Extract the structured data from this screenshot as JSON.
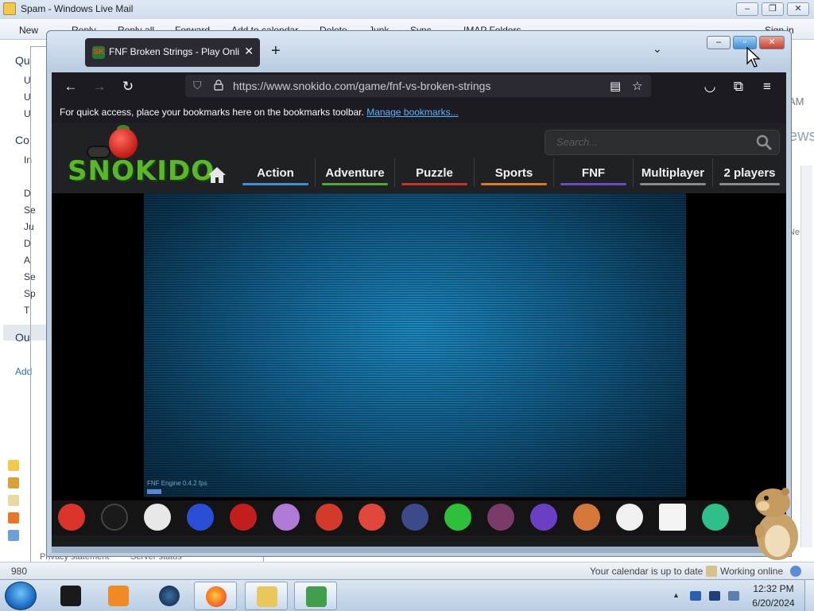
{
  "background_app": {
    "title": "Spam - Windows Live Mail",
    "ribbon": [
      "New",
      "Reply",
      "Reply all",
      "Forward",
      "Add to calendar",
      "Delete",
      "Junk",
      "Sync",
      "IMAP Folders",
      "Sign in"
    ],
    "sidebar_headers": [
      "Qu",
      "Co",
      "Ou"
    ],
    "sidebar_items": [
      "U",
      "U",
      "U",
      "In",
      "D",
      "Se",
      "Ju",
      "D",
      "A",
      "Se",
      "Sp",
      "T"
    ],
    "add_link": "Add",
    "right_fragments": [
      "AM",
      "ews",
      "Ne"
    ],
    "status_left": "980",
    "status_right_calendar": "Your calendar is up to date",
    "status_right_online": "Working online",
    "under_links": [
      "Privacy statement",
      "Server status"
    ]
  },
  "browser": {
    "tab_title": "FNF Broken Strings - Play Online",
    "tab_favicon": "SK",
    "url": "https://www.snokido.com/game/fnf-vs-broken-strings",
    "bookmarks_hint": "For quick access, place your bookmarks here on the bookmarks toolbar.",
    "bookmarks_link": "Manage bookmarks..."
  },
  "site": {
    "logo": "SNOKIDO",
    "search_placeholder": "Search...",
    "categories": [
      {
        "label": "Action",
        "color": "#3f8fd6"
      },
      {
        "label": "Adventure",
        "color": "#4fa832"
      },
      {
        "label": "Puzzle",
        "color": "#c8322a"
      },
      {
        "label": "Sports",
        "color": "#e07a1f"
      },
      {
        "label": "FNF",
        "color": "#6a4bc4"
      },
      {
        "label": "Multiplayer",
        "color": "#8a8a8a"
      },
      {
        "label": "2 players",
        "color": "#8a8a8a"
      }
    ],
    "game_overlay_text": "FNF Engine 0.4.2 fps",
    "thumbnails": [
      {
        "name": "boyfriend-icon",
        "color": "#d9332a"
      },
      {
        "name": "bomb-character-icon",
        "color": "#1a1a1a"
      },
      {
        "name": "cuphead-icon",
        "color": "#e8e8e8"
      },
      {
        "name": "sonic-exe-icon",
        "color": "#2a4fd6"
      },
      {
        "name": "impostor-icon",
        "color": "#c21e1e"
      },
      {
        "name": "mouse-character-icon",
        "color": "#b07bd6"
      },
      {
        "name": "mario-icon",
        "color": "#d43a2a"
      },
      {
        "name": "digital-circus-icon",
        "color": "#e0463a"
      },
      {
        "name": "dark-sonic-icon",
        "color": "#3a4a8a"
      },
      {
        "name": "green-blob-icon",
        "color": "#2fbf3a"
      },
      {
        "name": "girl-character-icon",
        "color": "#7a3a6a"
      },
      {
        "name": "catnap-icon",
        "color": "#6b3fc4"
      },
      {
        "name": "fox-character-icon",
        "color": "#d6773a"
      },
      {
        "name": "snoopy-icon",
        "color": "#f0f0f0"
      },
      {
        "name": "box-face-icon",
        "color": "#f4f4f4"
      },
      {
        "name": "green-hair-icon",
        "color": "#2fbf8a"
      }
    ]
  },
  "taskbar": {
    "time": "12:32 PM",
    "date": "6/20/2024"
  }
}
